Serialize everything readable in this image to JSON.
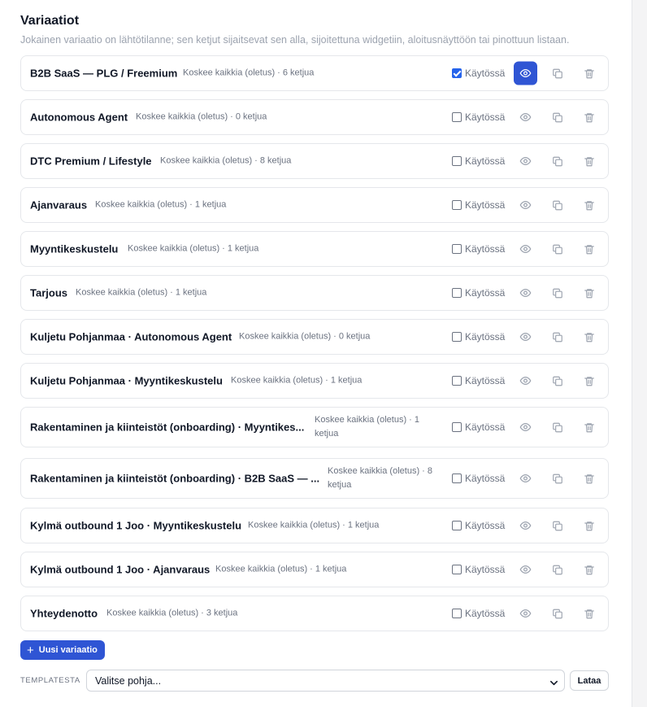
{
  "header": {
    "title": "Variaatiot",
    "subtitle": "Jokainen variaatio on lähtötilanne; sen ketjut sijaitsevat sen alla, sijoitettuna widgetiin, aloitusnäyttöön tai pinottuun listaan."
  },
  "colors": {
    "accent": "#2f55d4",
    "border": "#e5e7eb",
    "muted": "#6b7280"
  },
  "enabled_label": "Käytössä",
  "variations": [
    {
      "name": "B2B SaaS — PLG / Freemium",
      "meta": "Koskee kaikkia (oletus) · 6 ketjua",
      "enabled": true,
      "preview_active": true
    },
    {
      "name": "Autonomous Agent",
      "meta": "Koskee kaikkia (oletus) · 0 ketjua",
      "enabled": false,
      "preview_active": false
    },
    {
      "name": "DTC Premium / Lifestyle",
      "meta": "Koskee kaikkia (oletus) · 8 ketjua",
      "enabled": false,
      "preview_active": false
    },
    {
      "name": "Ajanvaraus",
      "meta": "Koskee kaikkia (oletus) · 1 ketjua",
      "enabled": false,
      "preview_active": false
    },
    {
      "name": "Myyntikeskustelu",
      "meta": "Koskee kaikkia (oletus) · 1 ketjua",
      "enabled": false,
      "preview_active": false
    },
    {
      "name": "Tarjous",
      "meta": "Koskee kaikkia (oletus) · 1 ketjua",
      "enabled": false,
      "preview_active": false
    },
    {
      "name": "Kuljetu Pohjanmaa · Autonomous Agent",
      "meta": "Koskee kaikkia (oletus) · 0 ketjua",
      "enabled": false,
      "preview_active": false
    },
    {
      "name": "Kuljetu Pohjanmaa · Myyntikeskustelu",
      "meta": "Koskee kaikkia (oletus) · 1 ketjua",
      "enabled": false,
      "preview_active": false
    },
    {
      "name": "Rakentaminen ja kiinteistöt (onboarding) · Myyntikes...",
      "meta": "Koskee kaikkia (oletus) · 1 ketjua",
      "enabled": false,
      "preview_active": false
    },
    {
      "name": "Rakentaminen ja kiinteistöt (onboarding) · B2B SaaS — ...",
      "meta": "Koskee kaikkia (oletus) · 8 ketjua",
      "enabled": false,
      "preview_active": false
    },
    {
      "name": "Kylmä outbound 1 Joo · Myyntikeskustelu",
      "meta": "Koskee kaikkia (oletus) · 1 ketjua",
      "enabled": false,
      "preview_active": false
    },
    {
      "name": "Kylmä outbound 1 Joo · Ajanvaraus",
      "meta": "Koskee kaikkia (oletus) · 1 ketjua",
      "enabled": false,
      "preview_active": false
    },
    {
      "name": "Yhteydenotto",
      "meta": "Koskee kaikkia (oletus) · 3 ketjua",
      "enabled": false,
      "preview_active": false
    }
  ],
  "actions": {
    "new_variation_label": "Uusi variaatio"
  },
  "template": {
    "label": "TEMPLATESTA",
    "select_value": "Valitse pohja...",
    "load_label": "Lataa"
  }
}
